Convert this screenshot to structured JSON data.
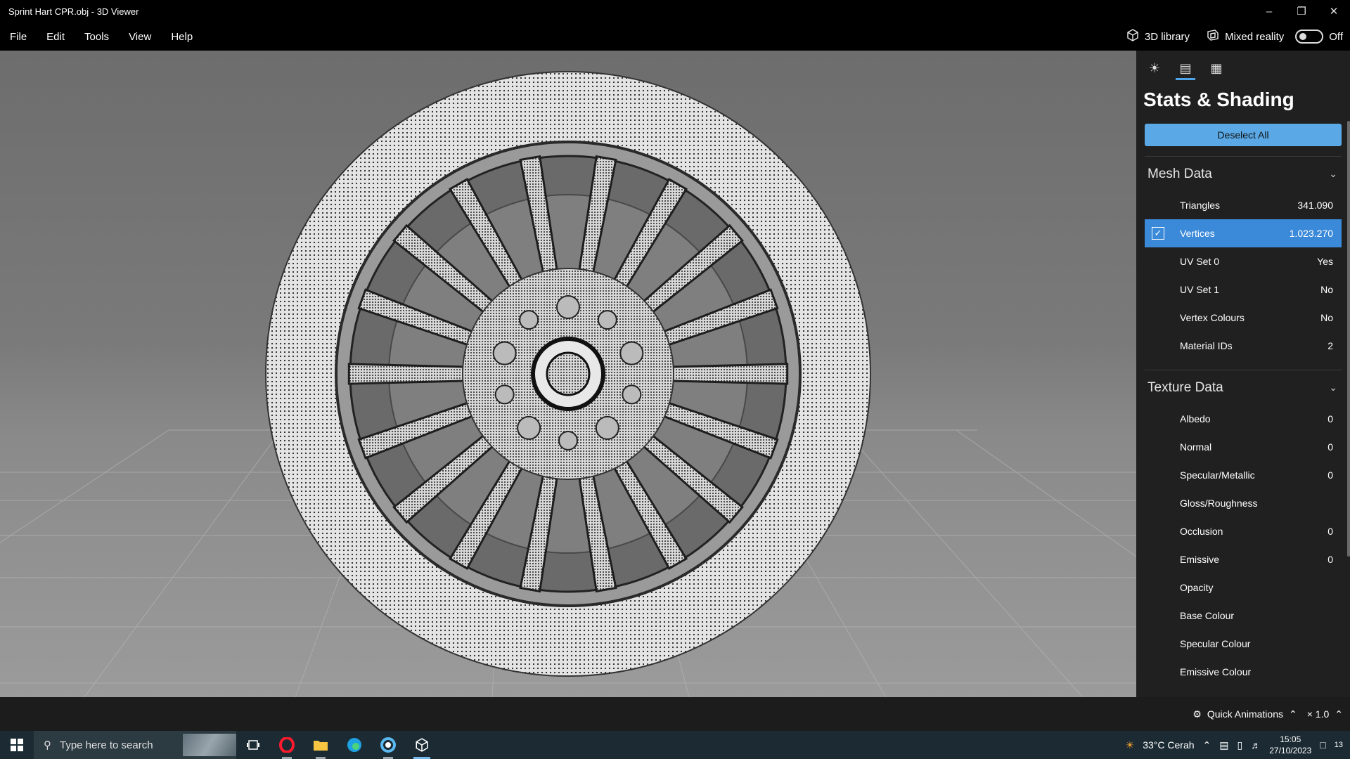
{
  "window": {
    "title": "Sprint Hart CPR.obj - 3D Viewer",
    "controls": [
      "minimize-icon",
      "restore-icon",
      "close-icon"
    ]
  },
  "menu": {
    "items": [
      "File",
      "Edit",
      "Tools",
      "View",
      "Help"
    ],
    "library": "3D library",
    "mixed_reality": "Mixed reality",
    "mixed_reality_state": "Off"
  },
  "panel": {
    "tabs": [
      "lighting-icon",
      "stats-icon",
      "grid-icon"
    ],
    "title": "Stats & Shading",
    "deselect_label": "Deselect All",
    "mesh_header": "Mesh Data",
    "mesh_rows": [
      {
        "label": "Triangles",
        "value": "341.090"
      },
      {
        "label": "Vertices",
        "value": "1.023.270",
        "checked": true
      },
      {
        "label": "UV Set 0",
        "value": "Yes"
      },
      {
        "label": "UV Set 1",
        "value": "No"
      },
      {
        "label": "Vertex Colours",
        "value": "No"
      },
      {
        "label": "Material IDs",
        "value": "2"
      }
    ],
    "texture_header": "Texture Data",
    "texture_rows": [
      {
        "label": "Albedo",
        "value": "0"
      },
      {
        "label": "Normal",
        "value": "0"
      },
      {
        "label": "Specular/Metallic",
        "value": "0"
      },
      {
        "label": "Gloss/Roughness",
        "value": ""
      },
      {
        "label": "Occlusion",
        "value": "0"
      },
      {
        "label": "Emissive",
        "value": "0"
      },
      {
        "label": "Opacity",
        "value": ""
      },
      {
        "label": "Base Colour",
        "value": ""
      },
      {
        "label": "Specular Colour",
        "value": ""
      },
      {
        "label": "Emissive Colour",
        "value": ""
      }
    ]
  },
  "status": {
    "quick_animations": "Quick Animations",
    "speed": "× 1.0"
  },
  "taskbar": {
    "search_placeholder": "Type here to search",
    "weather": "33°C  Cerah",
    "time": "15:05",
    "date": "27/10/2023",
    "notifications": "13"
  },
  "colors": {
    "accent": "#3b8ad9",
    "button": "#5aa9e6",
    "panel_bg": "#202020"
  }
}
